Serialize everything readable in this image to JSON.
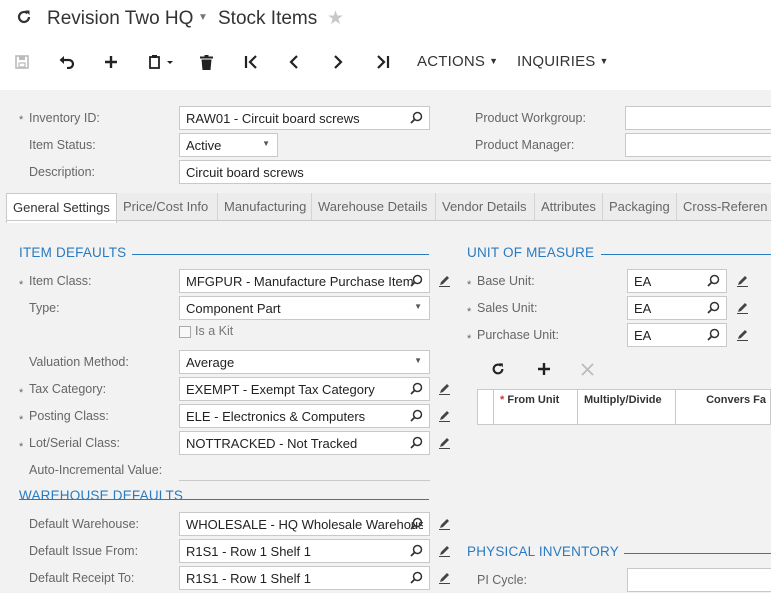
{
  "title": {
    "company": "Revision Two HQ",
    "screen": "Stock Items"
  },
  "toolbar": {
    "actions_label": "ACTIONS",
    "inquiries_label": "INQUIRIES"
  },
  "header": {
    "inventory_id_label": "Inventory ID:",
    "inventory_id_value": "RAW01 - Circuit board screws",
    "item_status_label": "Item Status:",
    "item_status_value": "Active",
    "description_label": "Description:",
    "description_value": "Circuit board screws",
    "product_workgroup_label": "Product Workgroup:",
    "product_workgroup_value": "",
    "product_manager_label": "Product Manager:",
    "product_manager_value": ""
  },
  "tabs": [
    {
      "label": "General Settings"
    },
    {
      "label": "Price/Cost Info"
    },
    {
      "label": "Manufacturing"
    },
    {
      "label": "Warehouse Details"
    },
    {
      "label": "Vendor Details"
    },
    {
      "label": "Attributes"
    },
    {
      "label": "Packaging"
    },
    {
      "label": "Cross-Referen"
    }
  ],
  "item_defaults": {
    "title": "ITEM DEFAULTS",
    "item_class_label": "Item Class:",
    "item_class_value": "MFGPUR - Manufacture Purchase Item",
    "type_label": "Type:",
    "type_value": "Component Part",
    "is_kit_label": "Is a Kit",
    "valuation_label": "Valuation Method:",
    "valuation_value": "Average",
    "tax_category_label": "Tax Category:",
    "tax_category_value": "EXEMPT - Exempt Tax Category",
    "posting_class_label": "Posting Class:",
    "posting_class_value": "ELE - Electronics & Computers",
    "lot_serial_label": "Lot/Serial Class:",
    "lot_serial_value": "NOTTRACKED - Not Tracked",
    "auto_inc_label": "Auto-Incremental Value:"
  },
  "warehouse_defaults": {
    "title": "WAREHOUSE DEFAULTS",
    "default_warehouse_label": "Default Warehouse:",
    "default_warehouse_value": "WHOLESALE - HQ Wholesale Warehouse",
    "default_issue_label": "Default Issue From:",
    "default_issue_value": "R1S1 - Row 1 Shelf 1",
    "default_receipt_label": "Default Receipt To:",
    "default_receipt_value": "R1S1 - Row 1 Shelf 1"
  },
  "unit_of_measure": {
    "title": "UNIT OF MEASURE",
    "base_unit_label": "Base Unit:",
    "base_unit_value": "EA",
    "sales_unit_label": "Sales Unit:",
    "sales_unit_value": "EA",
    "purchase_unit_label": "Purchase Unit:",
    "purchase_unit_value": "EA",
    "grid_columns": [
      "From Unit",
      "Multiply/Divide",
      "Convers Fa"
    ]
  },
  "physical_inventory": {
    "title": "PHYSICAL INVENTORY",
    "pi_cycle_label": "PI Cycle:",
    "pi_cycle_value": ""
  },
  "colors": {
    "accent": "#2a7abf",
    "form_bg": "#f2f2f2",
    "required_marker": "#e03030"
  }
}
